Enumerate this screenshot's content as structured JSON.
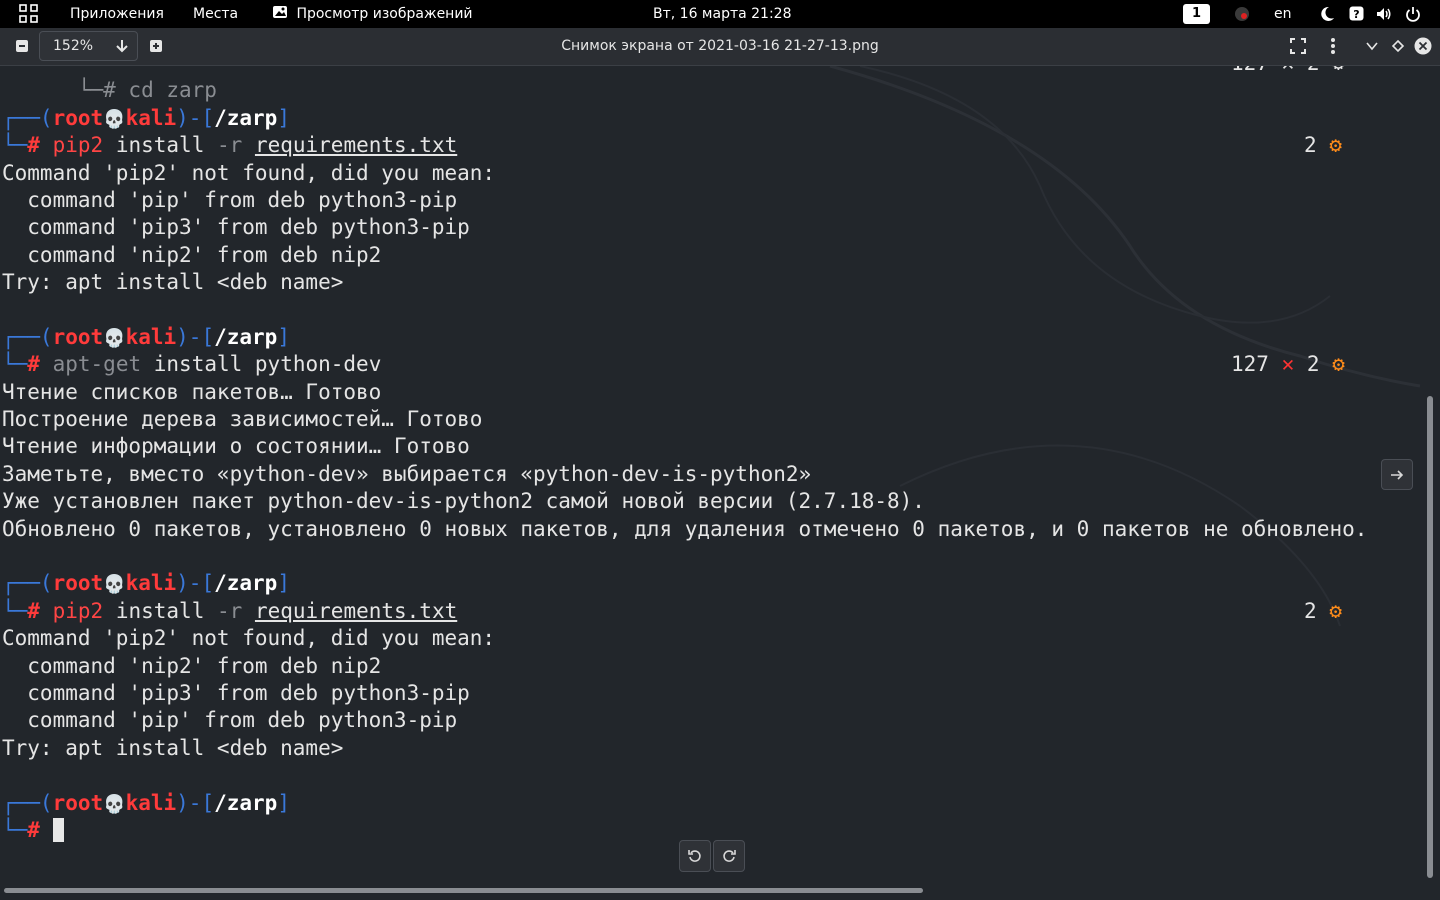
{
  "topbar": {
    "apps_label": "Приложения",
    "places_label": "Места",
    "active_app": "Просмотр изображений",
    "datetime": "Вт, 16 марта  21:28",
    "workspace": "1",
    "lang": "en"
  },
  "viewer": {
    "zoom": "152%",
    "title": "Снимок экрана от 2021-03-16 21-27-13.png"
  },
  "terminal": {
    "cut_top": "└─# cd zarp",
    "cut_status": "127 ✕ 2 ⚙",
    "prompt_user": "root",
    "prompt_host": "kali",
    "prompt_dir": "/zarp",
    "blocks": [
      {
        "cmd": "pip2",
        "args_plain": " install ",
        "opt": "-r",
        "file": "requirements.txt",
        "status": "2",
        "output": [
          "Command 'pip2' not found, did you mean:",
          "  command 'pip' from deb python3-pip",
          "  command 'pip3' from deb python3-pip",
          "  command 'nip2' from deb nip2",
          "Try: apt install <deb name>"
        ]
      },
      {
        "cmd": "apt-get",
        "args_plain": " install python-dev",
        "status_code": "127",
        "status": "2",
        "output": [
          "Чтение списков пакетов… Готово",
          "Построение дерева зависимостей… Готово",
          "Чтение информации о состоянии… Готово",
          "Заметьте, вместо «python-dev» выбирается «python-dev-is-python2»",
          "Уже установлен пакет python-dev-is-python2 самой новой версии (2.7.18-8).",
          "Обновлено 0 пакетов, установлено 0 новых пакетов, для удаления отмечено 0 пакетов, и 0 пакетов не обновлено."
        ]
      },
      {
        "cmd": "pip2",
        "args_plain": " install ",
        "opt": "-r",
        "file": "requirements.txt",
        "status": "2",
        "output": [
          "Command 'pip2' not found, did you mean:",
          "  command 'nip2' from deb nip2",
          "  command 'pip3' from deb python3-pip",
          "  command 'pip' from deb python3-pip",
          "Try: apt install <deb name>"
        ]
      }
    ]
  },
  "icons": {
    "gear": "⚙",
    "cross": "✕",
    "skull": "💀"
  }
}
